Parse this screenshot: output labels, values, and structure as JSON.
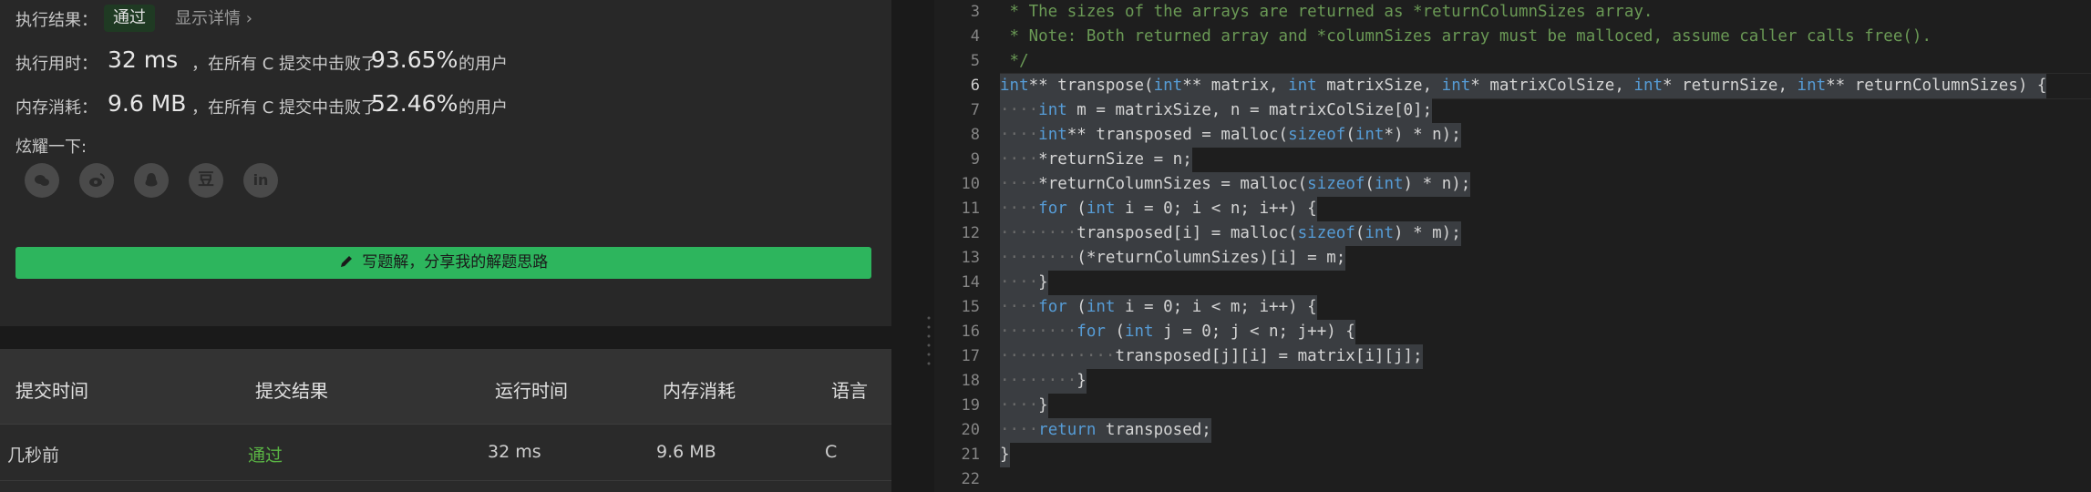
{
  "result": {
    "label_result": "执行结果：",
    "status": "通过",
    "detail_link": "显示详情",
    "detail_chevron": "›",
    "label_time": "执行用时：",
    "time_value": "32 ms",
    "time_desc": "，在所有 C 提交中击败了",
    "time_pct": "93.65%",
    "time_users": "的用户",
    "label_mem": "内存消耗：",
    "mem_value": "9.6 MB",
    "mem_desc": "，在所有 C 提交中击败了",
    "mem_pct": "52.46%",
    "mem_users": "的用户",
    "label_share": "炫耀一下:",
    "share_icons": [
      "wechat-icon",
      "weibo-icon",
      "qq-icon",
      "douban-icon",
      "linkedin-icon"
    ],
    "write_button": "写题解，分享我的解题思路",
    "douban_glyph": "豆",
    "linkedin_glyph": "in"
  },
  "submissions": {
    "headers": [
      "提交时间",
      "提交结果",
      "运行时间",
      "内存消耗",
      "语言"
    ],
    "rows": [
      {
        "time": "几秒前",
        "result": "通过",
        "runtime": "32 ms",
        "memory": "9.6 MB",
        "lang": "C"
      }
    ]
  },
  "colors": {
    "accent_green": "#2db55d",
    "pass_green": "#5ab544",
    "comment": "#6a9955",
    "keyword": "#569cd6"
  },
  "editor": {
    "line_numbers": [
      "3",
      "4",
      "5",
      "6",
      "7",
      "8",
      "9",
      "10",
      "11",
      "12",
      "13",
      "14",
      "15",
      "16",
      "17",
      "18",
      "19",
      "20",
      "21",
      "22"
    ],
    "current_line": "6"
  }
}
